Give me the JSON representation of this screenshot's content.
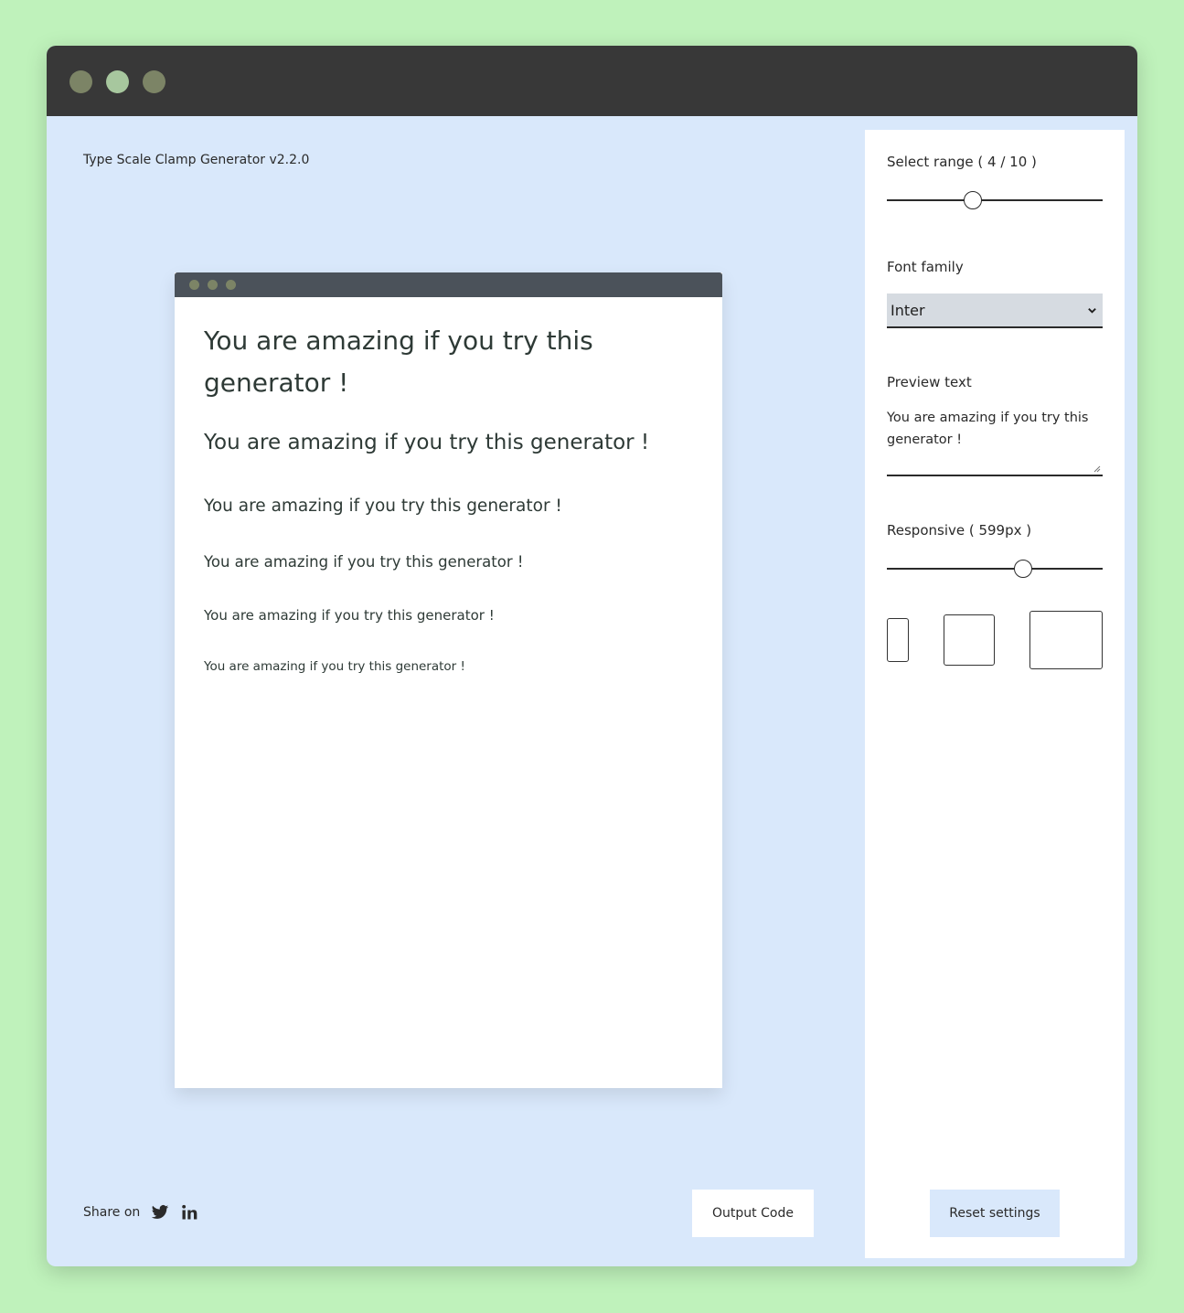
{
  "app": {
    "title": "Type Scale Clamp Generator v2.2.0"
  },
  "preview": {
    "lines": [
      "You are amazing if you try this generator !",
      "You are amazing if you try this generator !",
      "You are amazing if you try this generator !",
      "You are amazing if you try this generator !",
      "You are amazing if you try this generator !",
      "You are amazing if you try this generator !"
    ]
  },
  "footer": {
    "share_label": "Share on",
    "output_button": "Output Code"
  },
  "panel": {
    "range_label": "Select range ( 4 / 10 )",
    "range_value": 4,
    "range_max": 10,
    "font_family_label": "Font family",
    "font_family_selected": "Inter",
    "preview_text_label": "Preview text",
    "preview_text_value": "You are amazing if you try this generator !",
    "responsive_label": "Responsive ( 599px )",
    "responsive_fraction": 0.63,
    "reset_button": "Reset settings"
  },
  "icons": [
    "twitter-icon",
    "linkedin-icon",
    "chevron-down-icon"
  ],
  "colors": {
    "background": "#bff2bb",
    "titlebar": "#383838",
    "app_bg": "#d9e8fb",
    "select_bg": "#d6dbe1"
  }
}
